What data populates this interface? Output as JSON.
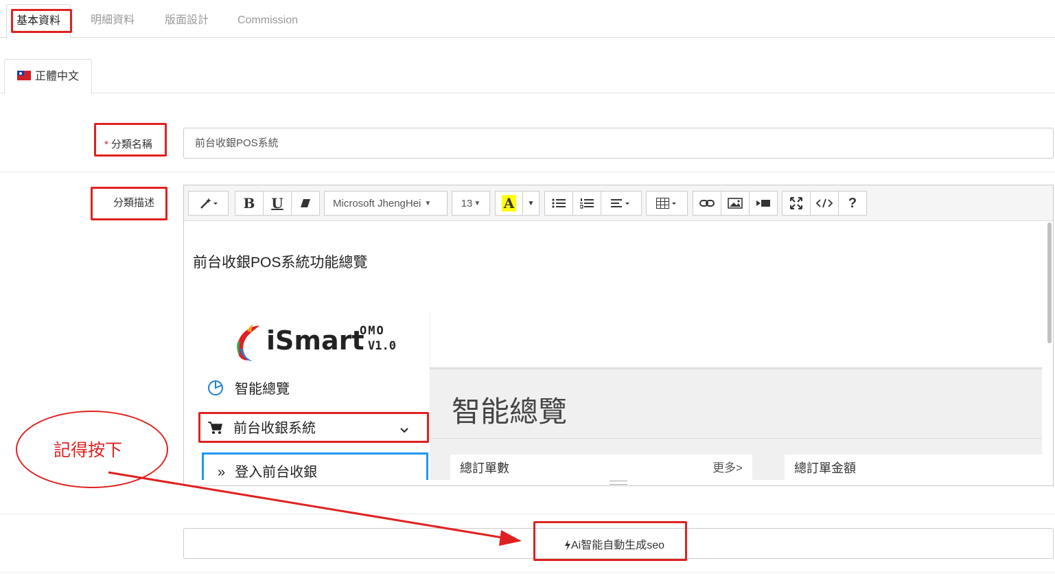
{
  "tabs": [
    {
      "label": "基本資料",
      "active": true
    },
    {
      "label": "明細資料",
      "active": false
    },
    {
      "label": "版面設計",
      "active": false
    },
    {
      "label": "Commission",
      "active": false
    }
  ],
  "language_tab": {
    "label": "正體中文",
    "flag_icon": "taiwan-flag-icon"
  },
  "form": {
    "category_name": {
      "required_mark": "*",
      "label": "分類名稱",
      "value": "前台收銀POS系統"
    },
    "category_description": {
      "label": "分類描述"
    }
  },
  "editor": {
    "toolbar": {
      "font_family": "Microsoft JhengHei",
      "font_size": "13",
      "bold": "B",
      "underline": "U",
      "color_letter": "A",
      "help": "?"
    },
    "content_title": "前台收銀POS系統功能總覽",
    "embedded_screenshot": {
      "logo_text": "iSmart",
      "logo_omo": "OMO",
      "logo_version": "V1.0",
      "sidebar": [
        {
          "label": "智能總覽"
        },
        {
          "label": "前台收銀系統"
        },
        {
          "label": "登入前台收銀",
          "prefix": "»"
        }
      ],
      "main_title": "智能總覽",
      "cards": [
        {
          "label": "總訂單數",
          "more": "更多>"
        },
        {
          "label": "總訂單金額"
        }
      ]
    }
  },
  "ai_button": {
    "label": "Ai智能自動生成seo"
  },
  "annotation": {
    "text": "記得按下"
  },
  "colors": {
    "highlight": "#e02020",
    "accent_blue": "#2196f3"
  }
}
